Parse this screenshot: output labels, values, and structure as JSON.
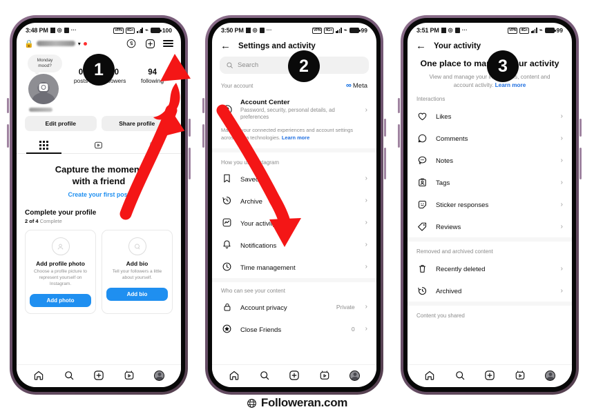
{
  "footer": {
    "brand": "Followeran.com",
    "icon": "globe-icon"
  },
  "badges": {
    "one": "1",
    "two": "2",
    "three": "3"
  },
  "colors": {
    "accent_blue": "#1f8ff0",
    "link_blue": "#1f6fe0",
    "meta_blue": "#0064e0",
    "arrow_red": "#f41616",
    "badge_black": "#0a0a0a",
    "frame_purple": "#7a5f78"
  },
  "screen1": {
    "status": {
      "time": "3:48 PM",
      "battery": "100",
      "icons": [
        "camera-icon",
        "instagram-icon",
        "save-icon",
        "more-dots"
      ],
      "net": "4G+",
      "wifi": "wifi-icon"
    },
    "header": {
      "lock": "lock-icon",
      "username_blurred": "",
      "chevron": "chevron-down-icon",
      "dot": "notification-dot",
      "threads": "threads-icon",
      "add": "plus-square-icon",
      "menu": "hamburger-menu-icon"
    },
    "note": "Monday mood?",
    "stats": [
      {
        "num": "0",
        "label": "posts"
      },
      {
        "num": "10",
        "label": "followers"
      },
      {
        "num": "94",
        "label": "following"
      }
    ],
    "buttons": {
      "edit": "Edit profile",
      "share": "Share profile"
    },
    "tabs": [
      "grid-tab",
      "reels-tab",
      "tagged-tab"
    ],
    "empty": {
      "title_line1": "Capture the moment",
      "title_line2": "with a friend",
      "link": "Create your first post"
    },
    "complete": {
      "title": "Complete your profile",
      "progress_num": "2 of 4",
      "progress_word": "Complete"
    },
    "cards": [
      {
        "icon": "person-circle-icon",
        "title": "Add profile photo",
        "desc": "Choose a profile picture to represent yourself on Instagram.",
        "button": "Add photo"
      },
      {
        "icon": "bio-circle-icon",
        "title": "Add bio",
        "desc": "Tell your followers a little about yourself.",
        "button": "Add bio"
      }
    ],
    "nav": [
      "home-icon",
      "search-icon",
      "create-icon",
      "reels-icon",
      "profile-avatar"
    ]
  },
  "screen2": {
    "status": {
      "time": "3:50 PM",
      "battery": "99"
    },
    "title": "Settings and activity",
    "back": "back-arrow-icon",
    "search_placeholder": "Search",
    "section_account": {
      "label": "Your account",
      "brand": "Meta"
    },
    "account_center": {
      "title": "Account Center",
      "subtitle": "Password, security, personal details, ad preferences",
      "note": "Manage your connected experiences and account settings across Meta technologies.",
      "note_link": "Learn more"
    },
    "section_usage": "How you use Instagram",
    "usage_items": [
      {
        "icon": "bookmark-icon",
        "label": "Saved"
      },
      {
        "icon": "archive-clock-icon",
        "label": "Archive"
      },
      {
        "icon": "activity-chart-icon",
        "label": "Your activity"
      },
      {
        "icon": "bell-icon",
        "label": "Notifications"
      },
      {
        "icon": "clock-icon",
        "label": "Time management"
      }
    ],
    "section_privacy": "Who can see your content",
    "privacy_items": [
      {
        "icon": "lock-icon",
        "label": "Account privacy",
        "value": "Private"
      },
      {
        "icon": "star-circle-icon",
        "label": "Close Friends",
        "value": "0"
      }
    ],
    "nav": [
      "home-icon",
      "search-icon",
      "create-icon",
      "reels-icon",
      "profile-avatar"
    ]
  },
  "screen3": {
    "status": {
      "time": "3:51 PM",
      "battery": "99"
    },
    "title": "Your activity",
    "back": "back-arrow-icon",
    "hero": {
      "heading": "One place to manage your activity",
      "desc": "View and manage your interactions, content and account activity.",
      "link": "Learn more"
    },
    "section_interactions": "Interactions",
    "interaction_items": [
      {
        "icon": "heart-icon",
        "label": "Likes"
      },
      {
        "icon": "comment-icon",
        "label": "Comments"
      },
      {
        "icon": "notes-icon",
        "label": "Notes"
      },
      {
        "icon": "tag-person-icon",
        "label": "Tags"
      },
      {
        "icon": "sticker-smile-icon",
        "label": "Sticker responses"
      },
      {
        "icon": "review-tag-icon",
        "label": "Reviews"
      }
    ],
    "section_removed": "Removed and archived content",
    "removed_items": [
      {
        "icon": "trash-icon",
        "label": "Recently deleted"
      },
      {
        "icon": "archive-clock-icon",
        "label": "Archived"
      }
    ],
    "section_shared": "Content you shared",
    "nav": [
      "home-icon",
      "search-icon",
      "create-icon",
      "reels-icon",
      "profile-avatar"
    ]
  }
}
